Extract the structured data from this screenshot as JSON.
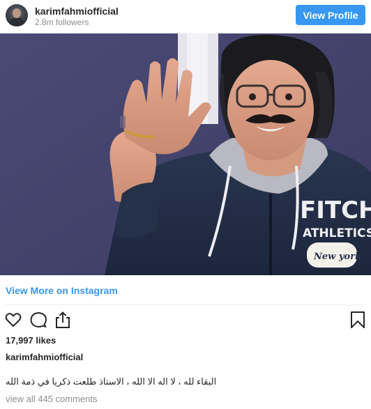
{
  "header": {
    "username": "karimfahmiofficial",
    "followers": "2.8m followers",
    "view_profile_label": "View Profile"
  },
  "photo": {
    "alt": "Man with mustache and glasses waving, wearing a navy hoodie",
    "hoodie_text_line1": "FITCH",
    "hoodie_text_line2": "ATHLETICS",
    "hoodie_text_line3": "New york"
  },
  "view_more_label": "View More on Instagram",
  "actions": {
    "like_icon": "heart-icon",
    "comment_icon": "comment-icon",
    "share_icon": "share-icon",
    "save_icon": "bookmark-icon"
  },
  "likes": "17,997 likes",
  "caption": {
    "username": "karimfahmiofficial",
    "text": "البقاء لله ، لا اله الا الله ، الاستاذ طلعت ذكريا في ذمة الله"
  },
  "comments_link": "view all 445 comments",
  "colors": {
    "accent": "#3897f0",
    "text": "#262626",
    "muted": "#8e8e8e",
    "divider": "#efefef"
  }
}
